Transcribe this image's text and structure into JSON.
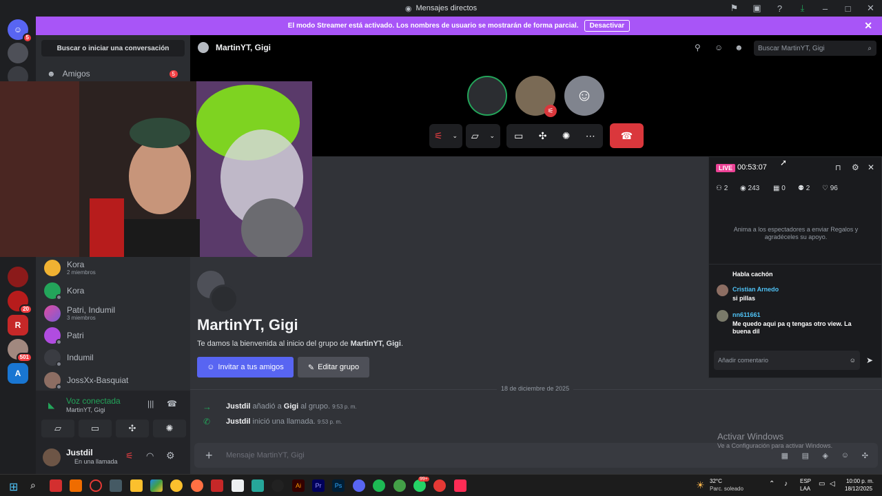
{
  "window": {
    "title": "Mensajes directos"
  },
  "banner": {
    "text": "El modo Streamer está activado. Los nombres de usuario se mostrarán de forma parcial.",
    "button": "Desactivar"
  },
  "servers": {
    "badges": [
      "5",
      "20",
      "501"
    ]
  },
  "dm_sidebar": {
    "search": "Buscar o iniciar una conversación",
    "friends": "Amigos",
    "friends_badge": "5",
    "items": [
      {
        "name": "Kora",
        "sub": "2 miembros"
      },
      {
        "name": "Kora",
        "sub": ""
      },
      {
        "name": "Patri, Indumil",
        "sub": "3 miembros"
      },
      {
        "name": "Patri",
        "sub": ""
      },
      {
        "name": "Indumil",
        "sub": ""
      },
      {
        "name": "JossXx-Basquiat",
        "sub": ""
      }
    ]
  },
  "voice": {
    "status": "Voz conectada",
    "channel": "MartinYT, Gigi"
  },
  "user": {
    "name": "Justdil",
    "status": "En una llamada"
  },
  "header": {
    "title": "MartinYT, Gigi",
    "search_placeholder": "Buscar MartinYT, Gigi"
  },
  "live": {
    "badge": "LIVE",
    "time": "00:53:07",
    "stats": {
      "members": "2",
      "viewers": "243",
      "gifts": "0",
      "followers": "2",
      "likes": "96"
    },
    "prompt": "Anima a los espectadores a enviar Regalos y agradéceles su apoyo.",
    "comments": [
      {
        "user": "",
        "text": "Habla cachón"
      },
      {
        "user": "Cristian Arnedo",
        "text": "si pillas"
      },
      {
        "user": "nn611661",
        "text": "Me quedo aqui pa q tengas otro view. La buena dil"
      }
    ],
    "input_placeholder": "Añadir comentario",
    "colors": {
      "live": "#ed4296",
      "user1": "#4fc3f7",
      "user2": "#4fc3f7"
    }
  },
  "chat": {
    "title": "MartinYT, Gigi",
    "welcome_prefix": "Te damos la bienvenida al inicio del grupo de ",
    "welcome_group": "MartinYT, Gigi",
    "welcome_suffix": ".",
    "invite": "Invitar a tus amigos",
    "edit": "Editar grupo",
    "date": "18 de diciembre de 2025",
    "messages": [
      {
        "user": "Justdil",
        "pre": " añadió a ",
        "target": "Gigi",
        "post": " al grupo.",
        "time": "9:53 p. m."
      },
      {
        "user": "Justdil",
        "pre": " inició una llamada.",
        "target": "",
        "post": "",
        "time": "9:53 p. m."
      }
    ],
    "input_placeholder": "Mensaje MartinYT, Gigi"
  },
  "windows_activation": {
    "title": "Activar Windows",
    "sub": "Ve a Configuración para activar Windows."
  },
  "taskbar": {
    "weather_temp": "32°C",
    "weather_desc": "Parc. soleado",
    "lang": "ESP",
    "lang2": "LAA",
    "time": "10:00 p. m.",
    "date": "18/12/2025",
    "notif_badge": "99+"
  }
}
